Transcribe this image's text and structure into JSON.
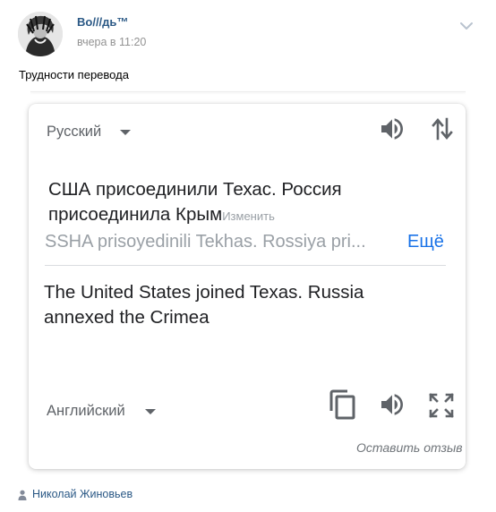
{
  "post": {
    "author_name": "Во///дь™",
    "time": "вчера в 11:20",
    "text": "Трудности перевода",
    "signer": "Николай Жиновьев"
  },
  "translator": {
    "source_language": "Русский",
    "target_language": "Английский",
    "source_text": "США присоединили Техас. Россия присоединила Крым",
    "edit_label": "Изменить",
    "transliteration": "SSHA prisoyedinili Tekhas. Rossiya pri...",
    "more_label": "Ещё",
    "translated_text": "The United States joined Texas. Russia annexed the Crimea",
    "feedback_label": "Оставить отзыв"
  },
  "colors": {
    "link": "#2a5885",
    "accent_blue": "#1a73e8",
    "icon_gray": "#5f6368",
    "muted_gray": "#9aa0a6"
  },
  "icons": {
    "chevron": "chevron-down-icon",
    "speaker": "speaker-icon",
    "swap": "swap-languages-icon",
    "copy": "copy-icon",
    "fullscreen": "fullscreen-icon",
    "person": "person-icon"
  }
}
